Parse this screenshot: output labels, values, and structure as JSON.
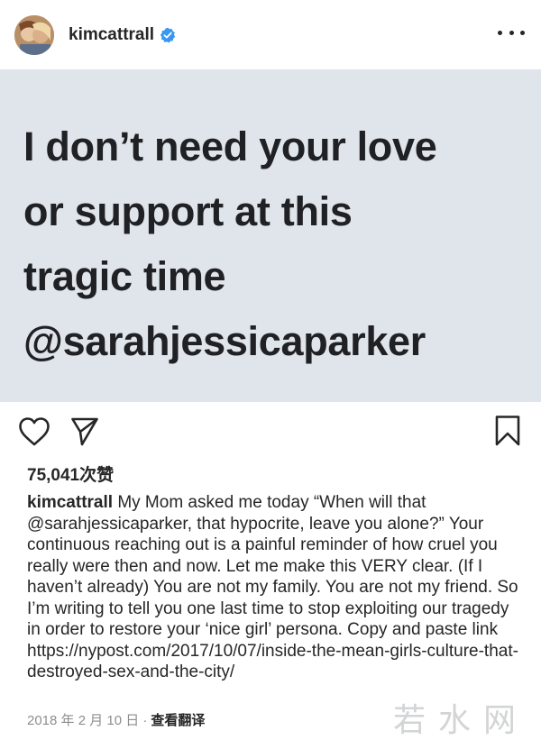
{
  "header": {
    "username": "kimcattrall",
    "more_label": "more options"
  },
  "image": {
    "lines": [
      "I don’t need your love",
      "or support at this",
      "tragic time",
      "@sarahjessicaparker"
    ]
  },
  "stats": {
    "likes": "75,041次赞"
  },
  "caption": {
    "username": "kimcattrall",
    "text_1": " My Mom asked me today “When will that ",
    "mention": "@sarahjessicaparker",
    "text_2": ", that hypocrite, leave you alone?” Your continuous reaching out is a painful reminder of how cruel you really were then and now. Let me make this VERY clear. (If I haven’t already) You are not my family. You are not my friend. So I’m writing to tell you one last time to stop exploiting our tragedy in order to restore your ‘nice girl’ persona. Copy and paste link ",
    "link": "https://nypost.com/2017/10/07/inside-the-mean-girls-culture-that-destroyed-sex-and-the-city/"
  },
  "footer": {
    "date": "2018 年 2 月 10 日 ·",
    "translate": "查看翻译"
  },
  "watermark": "若水网",
  "colors": {
    "verified": "#3897f0",
    "image_bg": "#e0e5eb",
    "text": "#262626",
    "muted": "#8e8e8e"
  }
}
